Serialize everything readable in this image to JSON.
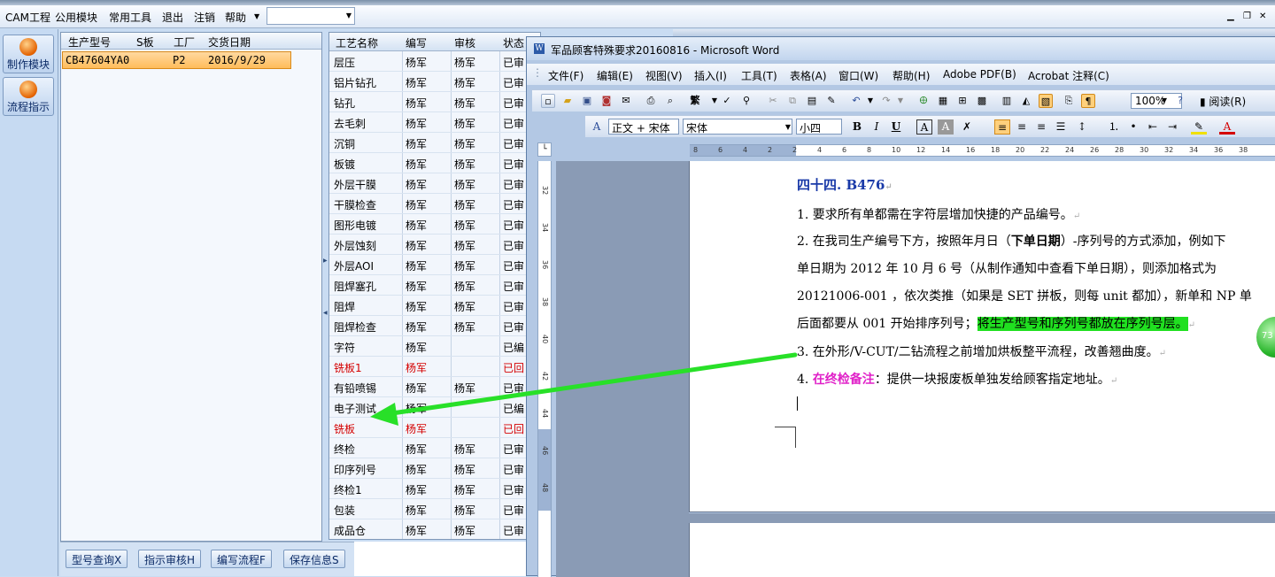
{
  "menubar": {
    "items": [
      "CAM工程",
      "公用模块",
      "常用工具",
      "退出",
      "注销",
      "帮助"
    ],
    "combo_value": ""
  },
  "left_panel": {
    "buttons": [
      "制作模块",
      "流程指示"
    ]
  },
  "order_grid": {
    "headers": [
      "生产型号",
      "S板",
      "工厂",
      "交货日期"
    ],
    "rows": [
      {
        "model": "CB47604YA0",
        "s_board": "",
        "factory": "P2",
        "delivery_date": "2016/9/29"
      }
    ]
  },
  "process_grid": {
    "headers": [
      "工艺名称",
      "编写",
      "审核",
      "状态"
    ],
    "rows": [
      {
        "name": "层压",
        "writer": "杨军",
        "reviewer": "杨军",
        "status": "已审",
        "red": false
      },
      {
        "name": "铝片钻孔",
        "writer": "杨军",
        "reviewer": "杨军",
        "status": "已审",
        "red": false
      },
      {
        "name": "钻孔",
        "writer": "杨军",
        "reviewer": "杨军",
        "status": "已审",
        "red": false
      },
      {
        "name": "去毛刺",
        "writer": "杨军",
        "reviewer": "杨军",
        "status": "已审",
        "red": false
      },
      {
        "name": "沉铜",
        "writer": "杨军",
        "reviewer": "杨军",
        "status": "已审",
        "red": false
      },
      {
        "name": "板镀",
        "writer": "杨军",
        "reviewer": "杨军",
        "status": "已审",
        "red": false
      },
      {
        "name": "外层干膜",
        "writer": "杨军",
        "reviewer": "杨军",
        "status": "已审",
        "red": false
      },
      {
        "name": "干膜检查",
        "writer": "杨军",
        "reviewer": "杨军",
        "status": "已审",
        "red": false
      },
      {
        "name": "图形电镀",
        "writer": "杨军",
        "reviewer": "杨军",
        "status": "已审",
        "red": false
      },
      {
        "name": "外层蚀刻",
        "writer": "杨军",
        "reviewer": "杨军",
        "status": "已审",
        "red": false
      },
      {
        "name": "外层AOI",
        "writer": "杨军",
        "reviewer": "杨军",
        "status": "已审",
        "red": false
      },
      {
        "name": "阻焊塞孔",
        "writer": "杨军",
        "reviewer": "杨军",
        "status": "已审",
        "red": false
      },
      {
        "name": "阻焊",
        "writer": "杨军",
        "reviewer": "杨军",
        "status": "已审",
        "red": false
      },
      {
        "name": "阻焊检查",
        "writer": "杨军",
        "reviewer": "杨军",
        "status": "已审",
        "red": false
      },
      {
        "name": "字符",
        "writer": "杨军",
        "reviewer": "",
        "status": "已编",
        "red": false
      },
      {
        "name": "铣板1",
        "writer": "杨军",
        "reviewer": "",
        "status": "已回",
        "red": true
      },
      {
        "name": "有铅喷锡",
        "writer": "杨军",
        "reviewer": "杨军",
        "status": "已审",
        "red": false
      },
      {
        "name": "电子测试",
        "writer": "杨军",
        "reviewer": "",
        "status": "已编",
        "red": false
      },
      {
        "name": "铣板",
        "writer": "杨军",
        "reviewer": "",
        "status": "已回",
        "red": true
      },
      {
        "name": "终检",
        "writer": "杨军",
        "reviewer": "杨军",
        "status": "已审",
        "red": false
      },
      {
        "name": "印序列号",
        "writer": "杨军",
        "reviewer": "杨军",
        "status": "已审",
        "red": false
      },
      {
        "name": "终检1",
        "writer": "杨军",
        "reviewer": "杨军",
        "status": "已审",
        "red": false
      },
      {
        "name": "包装",
        "writer": "杨军",
        "reviewer": "杨军",
        "status": "已审",
        "red": false
      },
      {
        "name": "成品仓",
        "writer": "杨军",
        "reviewer": "杨军",
        "status": "已审",
        "red": false
      }
    ]
  },
  "bottom_buttons": [
    "型号查询X",
    "指示审核H",
    "编写流程F",
    "保存信息S"
  ],
  "word": {
    "title": "军品顾客特殊要求20160816 - Microsoft Word",
    "menu": [
      "文件(F)",
      "编辑(E)",
      "视图(V)",
      "插入(I)",
      "工具(T)",
      "表格(A)",
      "窗口(W)",
      "帮助(H)",
      "Adobe PDF(B)",
      "Acrobat 注释(C)"
    ],
    "zoom": "100%",
    "read_label": "阅读(R)",
    "style_value": "正文 + 宋体",
    "font_value": "宋体",
    "size_value": "小四",
    "fan_label": "繁",
    "ruler_h": [
      "8",
      "6",
      "4",
      "2",
      "2",
      "4",
      "6",
      "8",
      "10",
      "12",
      "14",
      "16",
      "18",
      "20",
      "22",
      "24",
      "26",
      "28",
      "30",
      "32",
      "34",
      "36",
      "38"
    ],
    "ruler_v": [
      "32",
      "34",
      "36",
      "38",
      "40",
      "42",
      "44",
      "46",
      "48"
    ],
    "doc": {
      "heading": "四十四. B476",
      "line1": "1. 要求所有单都需在字符层增加快捷的产品编号。",
      "line2a": "2. 在我司生产编号下方，按照年月日（",
      "line2b": "下单日期",
      "line2c": "）-序列号的方式添加，例如下",
      "line3": "单日期为 2012 年 10 月 6 号（从制作通知中查看下单日期），则添加格式为",
      "line4": "20121006-001 ，依次类推（如果是 SET 拼板，则每 unit 都加），新单和 NP 单",
      "line5a": "后面都要从 001 开始排序列号；",
      "line5b": "将生产型号和序列号都放在序列号层。",
      "line6": "3. 在外形/V-CUT/二钻流程之前增加烘板整平流程，改善翘曲度。",
      "line7a": "4. ",
      "line7b": "在终检备注",
      "line7c": "：提供一块报废板单独发给顾客指定地址。"
    }
  },
  "bubble_text": "73"
}
